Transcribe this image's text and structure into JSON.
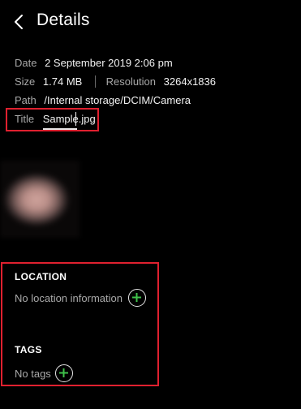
{
  "header": {
    "title": "Details",
    "back_icon": "chevron-left-icon"
  },
  "details": {
    "date_label": "Date",
    "date_value": "2 September 2019 2:06 pm",
    "size_label": "Size",
    "size_value": "1.74 MB",
    "resolution_label": "Resolution",
    "resolution_value": "3264x1836",
    "path_label": "Path",
    "path_value": "/Internal storage/DCIM/Camera",
    "title_label": "Title",
    "title_value": "Sample.jpg"
  },
  "location": {
    "heading": "LOCATION",
    "text": "No location information",
    "add_icon": "plus-circle-icon"
  },
  "tags": {
    "heading": "TAGS",
    "text": "No tags",
    "add_icon": "plus-circle-icon"
  },
  "colors": {
    "background": "#000000",
    "highlight_border": "#e0202f",
    "accent_plus": "#3fc14a",
    "label_gray": "#a8a8a8"
  }
}
